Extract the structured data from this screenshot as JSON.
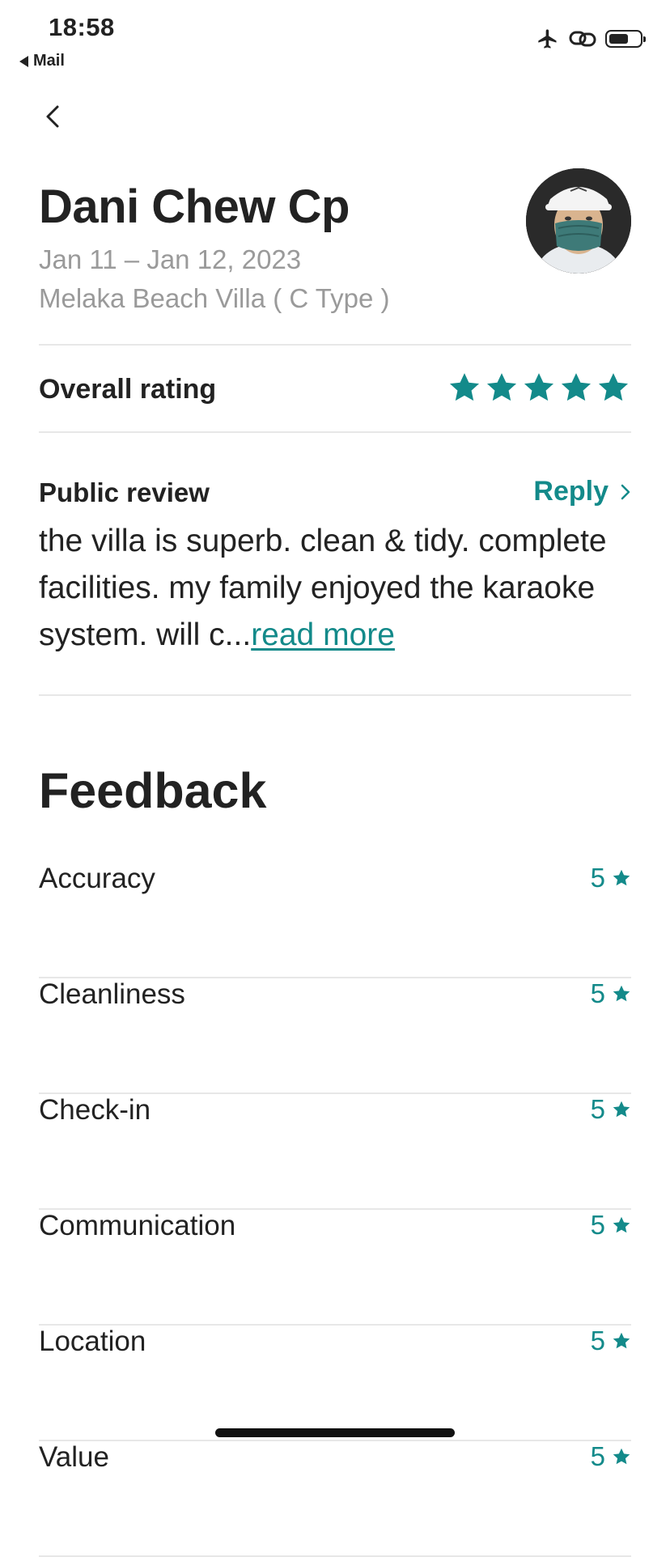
{
  "status_bar": {
    "time": "18:58",
    "back_app": "Mail"
  },
  "review": {
    "guest_name": "Dani Chew Cp",
    "dates": "Jan 11 – Jan 12, 2023",
    "listing": "Melaka Beach Villa ( C Type )",
    "overall_label": "Overall rating",
    "overall_stars": 5,
    "public_review_label": "Public review",
    "reply_label": "Reply",
    "review_text": "the villa is superb. clean & tidy. complete facilities. my family enjoyed the karaoke system. will c...",
    "read_more": "read more"
  },
  "feedback": {
    "title": "Feedback",
    "items": [
      {
        "label": "Accuracy",
        "score": "5"
      },
      {
        "label": "Cleanliness",
        "score": "5"
      },
      {
        "label": "Check-in",
        "score": "5"
      },
      {
        "label": "Communication",
        "score": "5"
      },
      {
        "label": "Location",
        "score": "5"
      },
      {
        "label": "Value",
        "score": "5"
      }
    ]
  },
  "colors": {
    "accent": "#138a8a",
    "muted_text": "#9a9a9a",
    "divider": "#e7e7e7"
  },
  "icons": {
    "back": "chevron-left-icon",
    "airplane": "airplane-icon",
    "link": "link-icon",
    "battery": "battery-icon",
    "star": "star-icon"
  }
}
